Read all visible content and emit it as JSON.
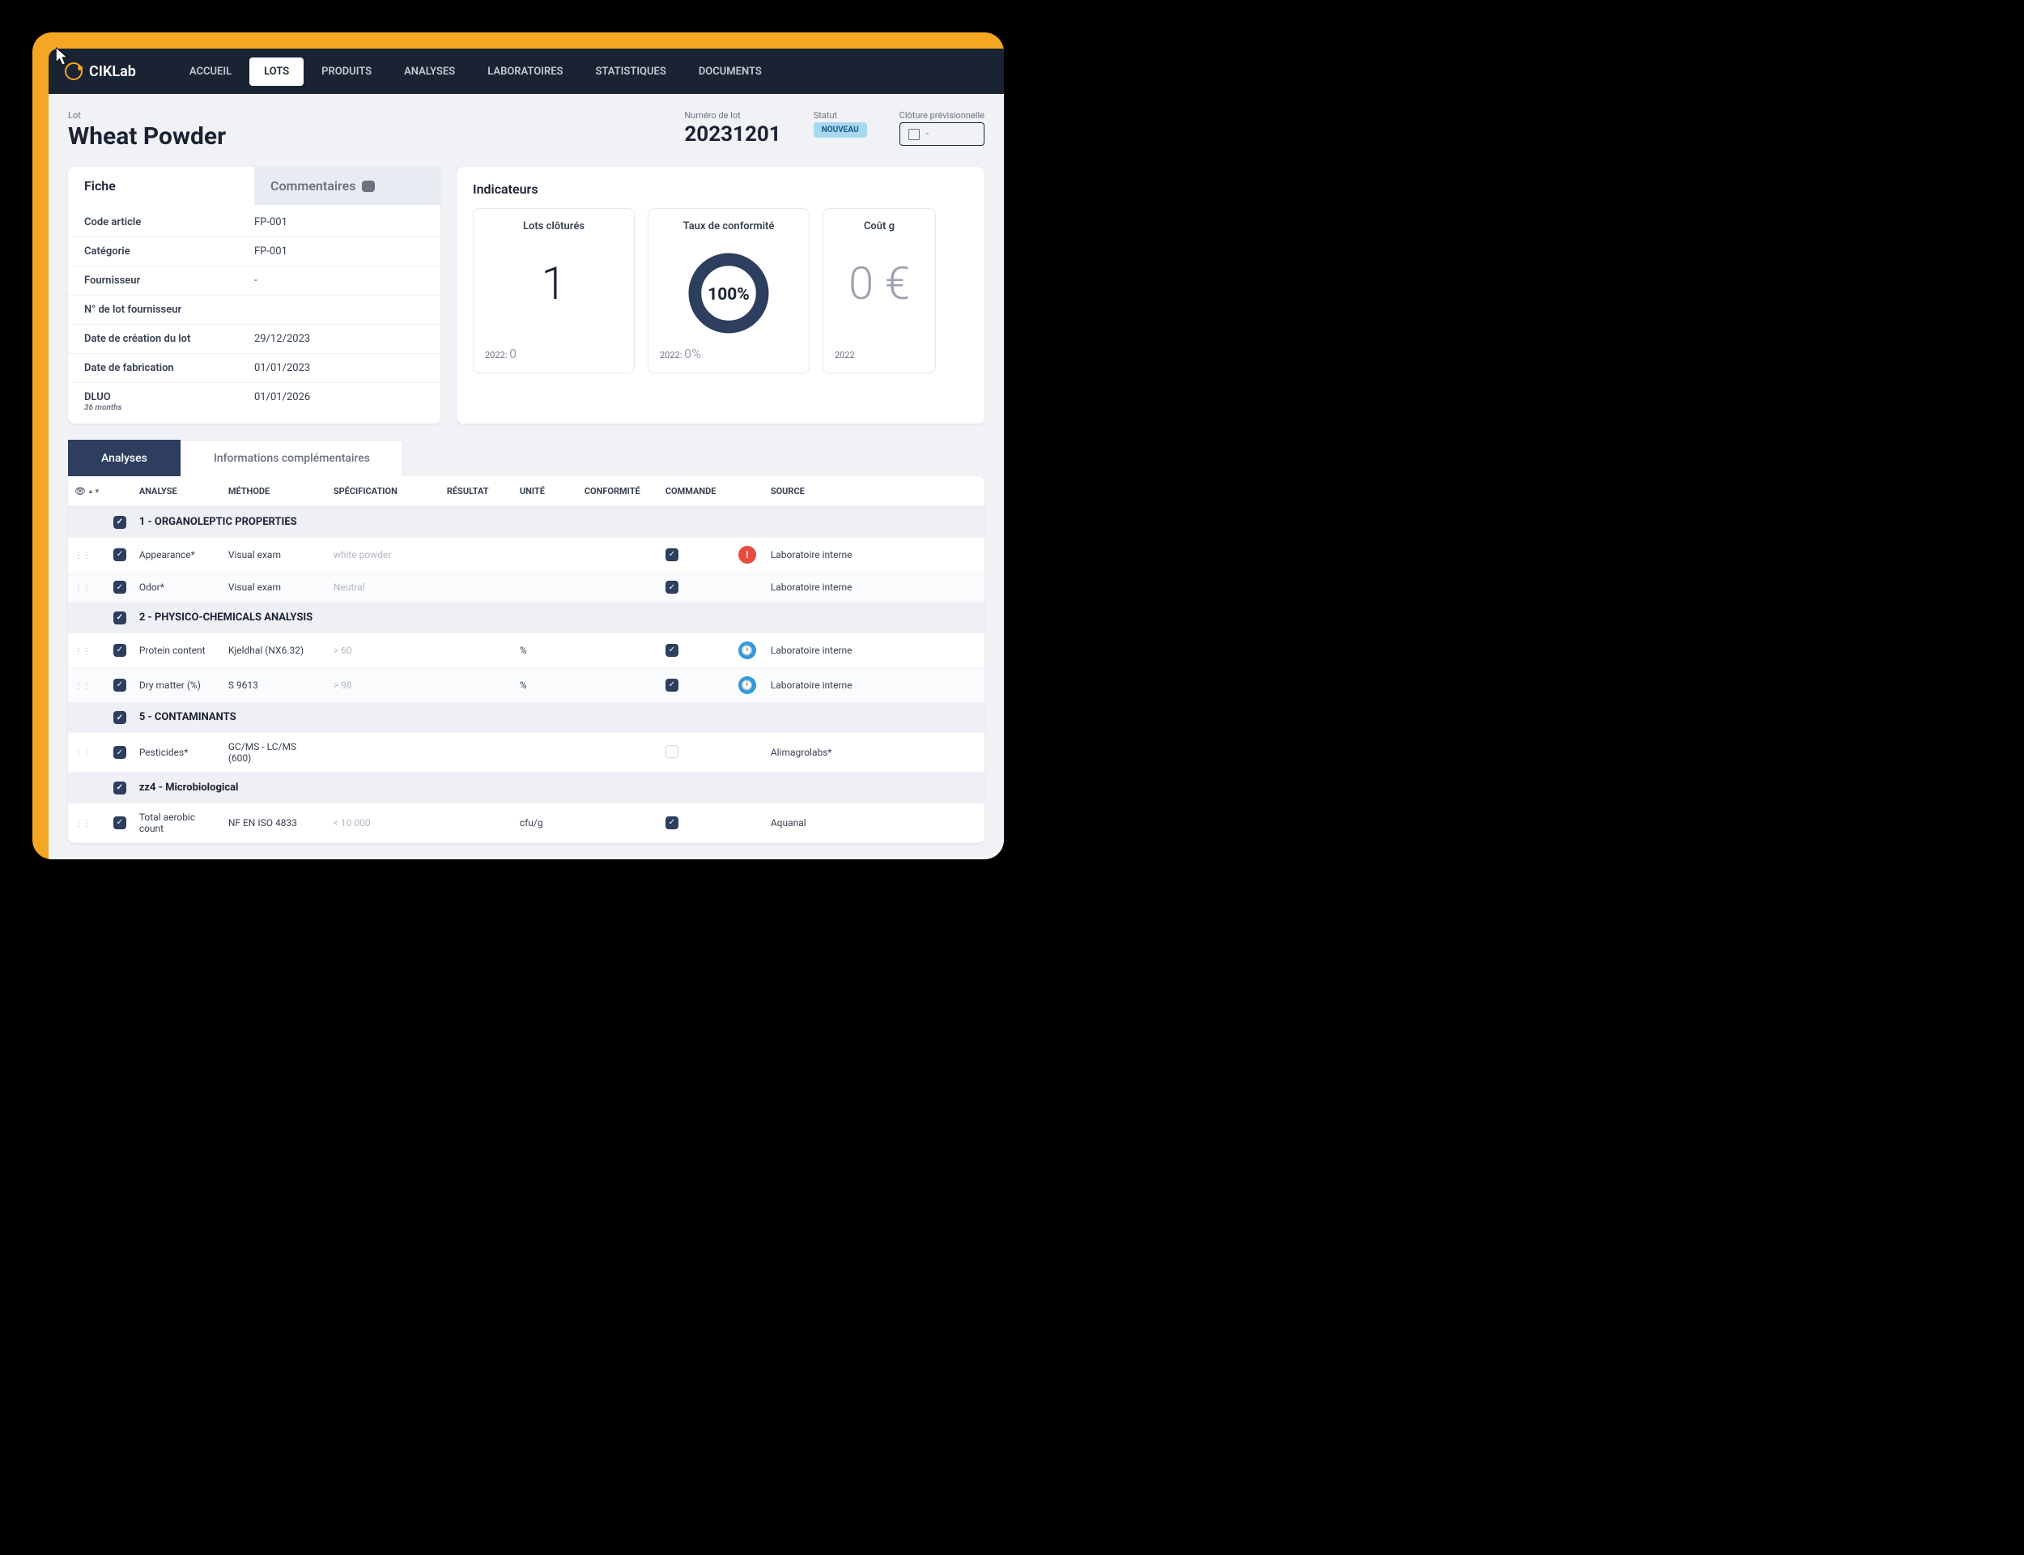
{
  "brand": "CIKLab",
  "nav": [
    "ACCUEIL",
    "LOTS",
    "PRODUITS",
    "ANALYSES",
    "LABORATOIRES",
    "STATISTIQUES",
    "DOCUMENTS"
  ],
  "nav_active_index": 1,
  "header": {
    "lot_label": "Lot",
    "lot_name": "Wheat Powder",
    "lotnum_label": "Numéro de lot",
    "lotnum": "20231201",
    "status_label": "Statut",
    "status_badge": "NOUVEAU",
    "closure_label": "Clôture prévisionnelle",
    "closure_value": "-"
  },
  "fiche": {
    "tab_fiche": "Fiche",
    "tab_comments": "Commentaires",
    "rows": [
      {
        "label": "Code article",
        "value": "FP-001"
      },
      {
        "label": "Catégorie",
        "value": "FP-001"
      },
      {
        "label": "Fournisseur",
        "value": "-"
      },
      {
        "label": "N° de lot fournisseur",
        "value": ""
      },
      {
        "label": "Date de création du lot",
        "value": "29/12/2023"
      },
      {
        "label": "Date de fabrication",
        "value": "01/01/2023"
      },
      {
        "label": "DLUO",
        "sub": "36 months",
        "value": "01/01/2026"
      }
    ]
  },
  "indicators": {
    "title": "Indicateurs",
    "boxes": [
      {
        "title": "Lots clôturés",
        "big": "1",
        "foot_label": "2022:",
        "foot_val": "0"
      },
      {
        "title": "Taux de conformité",
        "donut": "100%",
        "foot_label": "2022:",
        "foot_val": "0%"
      },
      {
        "title": "Coût g",
        "big": "0 €",
        "foot_label": "2022",
        "foot_val": ""
      }
    ]
  },
  "content_tabs": {
    "active": "Analyses",
    "inactive": "Informations complémentaires"
  },
  "table": {
    "headers": [
      "",
      "",
      "ANALYSE",
      "MÉTHODE",
      "SPÉCIFICATION",
      "RÉSULTAT",
      "UNITÉ",
      "CONFORMITÉ",
      "COMMANDE",
      "",
      "SOURCE"
    ],
    "groups": [
      {
        "title": "1 - ORGANOLEPTIC PROPERTIES",
        "rows": [
          {
            "analyse": "Appearance*",
            "methode": "Visual exam",
            "spec": "white powder",
            "unite": "",
            "cmd": true,
            "status": "alert",
            "source": "Laboratoire interne"
          },
          {
            "analyse": "Odor*",
            "methode": "Visual exam",
            "spec": "Neutral",
            "unite": "",
            "cmd": true,
            "status": "",
            "source": "Laboratoire interne"
          }
        ]
      },
      {
        "title": "2 - PHYSICO-CHEMICALS ANALYSIS",
        "rows": [
          {
            "analyse": "Protein content",
            "methode": "Kjeldhal (NX6.32)",
            "spec": "> 60",
            "unite": "%",
            "cmd": true,
            "status": "clock",
            "source": "Laboratoire interne"
          },
          {
            "analyse": "Dry matter (%)",
            "methode": "S 9613",
            "spec": "> 98",
            "unite": "%",
            "cmd": true,
            "status": "clock",
            "source": "Laboratoire interne"
          }
        ]
      },
      {
        "title": "5 - CONTAMINANTS",
        "rows": [
          {
            "analyse": "Pesticides*",
            "methode": "GC/MS - LC/MS (600)",
            "spec": "",
            "unite": "",
            "cmd": false,
            "status": "",
            "source": "Alimagrolabs*"
          }
        ]
      },
      {
        "title": "zz4 - Microbiological",
        "rows": [
          {
            "analyse": "Total aerobic count",
            "methode": "NF EN ISO 4833",
            "spec": "< 10 000",
            "unite": "cfu/g",
            "cmd": true,
            "status": "",
            "source": "Aquanal"
          }
        ]
      }
    ]
  }
}
